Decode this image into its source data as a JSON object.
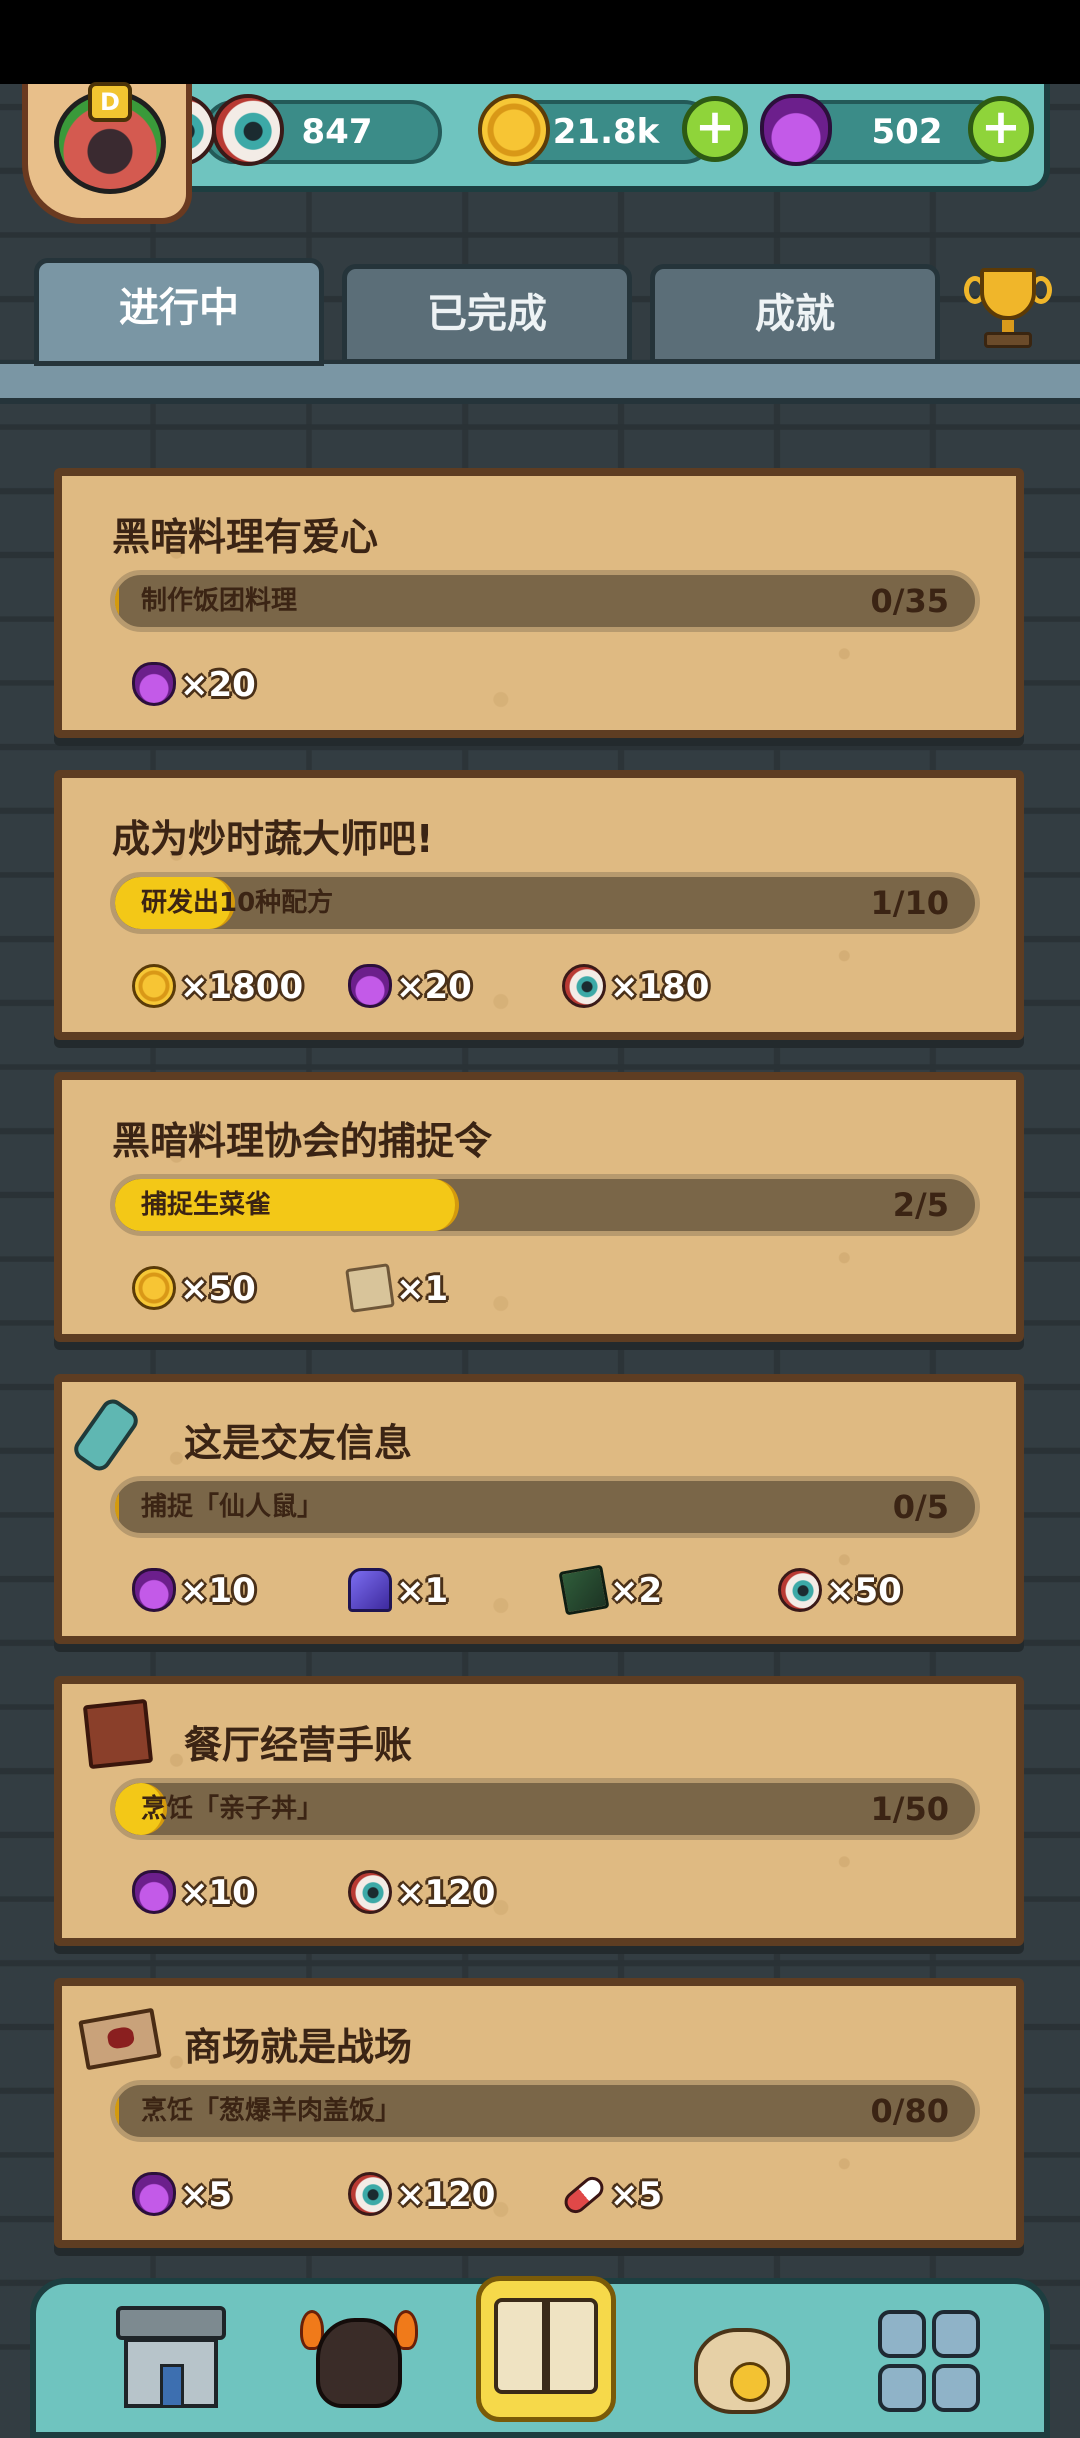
{
  "header": {
    "rank": "D",
    "eyeballs": "847",
    "coins": "21.8k",
    "potions": "502",
    "plus": "+"
  },
  "tabs": [
    {
      "label": "进行中",
      "active": true
    },
    {
      "label": "已完成",
      "active": false
    },
    {
      "label": "成就",
      "active": false
    }
  ],
  "quests": [
    {
      "title": "黑暗料理有爱心",
      "task": "制作饭团料理",
      "count": "0/35",
      "progress": 0.0,
      "rewards": [
        {
          "icon": "potion-icon",
          "amount": "×20"
        }
      ]
    },
    {
      "title": "成为炒时蔬大师吧!",
      "task": "研发出10种配方",
      "count": "1/10",
      "progress": 0.1,
      "rewards": [
        {
          "icon": "coin-icon",
          "amount": "×1800"
        },
        {
          "icon": "potion-icon",
          "amount": "×20"
        },
        {
          "icon": "eyeball-icon",
          "amount": "×180"
        }
      ]
    },
    {
      "title": "黑暗料理协会的捕捉令",
      "task": "捕捉生菜雀",
      "count": "2/5",
      "progress": 0.4,
      "rewards": [
        {
          "icon": "coin-icon",
          "amount": "×50"
        },
        {
          "icon": "scroll-icon",
          "amount": "×1"
        }
      ]
    },
    {
      "title": "这是交友信息",
      "task": "捕捉「仙人鼠」",
      "count": "0/5",
      "progress": 0.0,
      "title_icon": "message-bottle-icon",
      "rewards": [
        {
          "icon": "potion-icon",
          "amount": "×10"
        },
        {
          "icon": "crystal-icon",
          "amount": "×1"
        },
        {
          "icon": "card-icon",
          "amount": "×2"
        },
        {
          "icon": "eyeball-icon",
          "amount": "×50"
        }
      ]
    },
    {
      "title": "餐厅经营手账",
      "task": "烹饪「亲子丼」",
      "count": "1/50",
      "progress": 0.02,
      "title_icon": "book-icon",
      "rewards": [
        {
          "icon": "potion-icon",
          "amount": "×10"
        },
        {
          "icon": "eyeball-icon",
          "amount": "×120"
        }
      ]
    },
    {
      "title": "商场就是战场",
      "task": "烹饪「葱爆羊肉盖饭」",
      "count": "0/80",
      "progress": 0.0,
      "title_icon": "map-icon",
      "rewards": [
        {
          "icon": "potion-icon",
          "amount": "×5"
        },
        {
          "icon": "eyeball-icon",
          "amount": "×120"
        },
        {
          "icon": "pill-icon",
          "amount": "×5"
        }
      ]
    }
  ],
  "bottom_nav": [
    {
      "icon": "shop-icon"
    },
    {
      "icon": "monster-icon"
    },
    {
      "icon": "quest-book-icon",
      "active": true
    },
    {
      "icon": "coin-bag-icon"
    },
    {
      "icon": "menu-grid-icon"
    }
  ]
}
